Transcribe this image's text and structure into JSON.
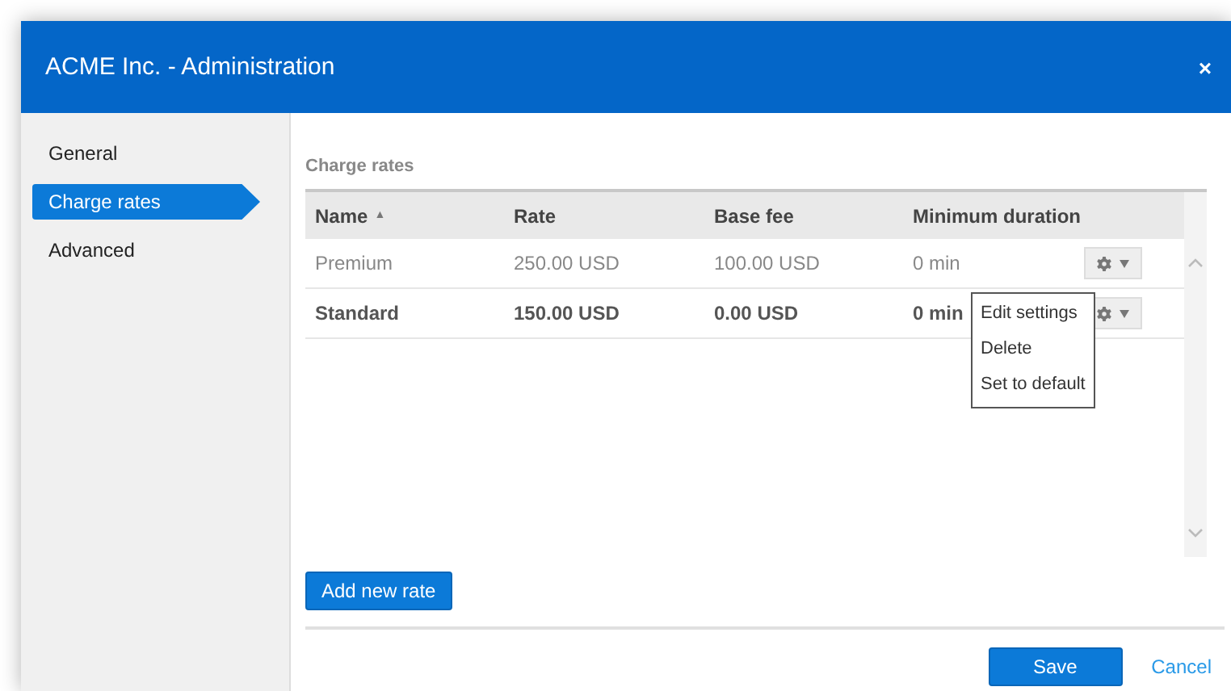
{
  "window": {
    "title": "ACME Inc. - Administration",
    "close": "×"
  },
  "sidebar": {
    "items": [
      {
        "label": "General",
        "selected": false
      },
      {
        "label": "Charge rates",
        "selected": true
      },
      {
        "label": "Advanced",
        "selected": false
      }
    ]
  },
  "section_title": "Charge rates",
  "table": {
    "columns": [
      {
        "label": "Name",
        "sort": "▲"
      },
      {
        "label": "Rate"
      },
      {
        "label": "Base fee"
      },
      {
        "label": "Minimum duration"
      }
    ],
    "rows": [
      {
        "cells": [
          "Premium",
          "250.00 USD",
          "100.00 USD",
          "0 min"
        ],
        "is_default": false,
        "menu_open": false
      },
      {
        "cells": [
          "Standard",
          "150.00 USD",
          "0.00 USD",
          "0 min"
        ],
        "is_default": true,
        "menu_open": true
      }
    ]
  },
  "row_menu": {
    "items": [
      "Edit settings",
      "Delete",
      "Set to default"
    ]
  },
  "add_button": "Add new rate",
  "footer": {
    "save": "Save",
    "cancel": "Cancel"
  }
}
